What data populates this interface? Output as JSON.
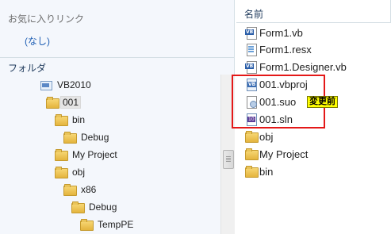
{
  "favorites": {
    "title": "お気に入りリンク",
    "empty": "(なし)"
  },
  "folders": {
    "title": "フォルダ",
    "tree": [
      {
        "label": "VB2010",
        "icon": "project-icon"
      },
      {
        "label": "001",
        "icon": "folder-icon",
        "selected": true
      },
      {
        "label": "bin",
        "icon": "folder-icon"
      },
      {
        "label": "Debug",
        "icon": "folder-icon"
      },
      {
        "label": "My Project",
        "icon": "folder-icon"
      },
      {
        "label": "obj",
        "icon": "folder-icon"
      },
      {
        "label": "x86",
        "icon": "folder-icon"
      },
      {
        "label": "Debug",
        "icon": "folder-icon"
      },
      {
        "label": "TempPE",
        "icon": "folder-icon"
      }
    ]
  },
  "file_list": {
    "column_header": "名前",
    "files": [
      {
        "label": "Form1.vb",
        "icon": "vb-file-icon"
      },
      {
        "label": "Form1.resx",
        "icon": "resx-file-icon"
      },
      {
        "label": "Form1.Designer.vb",
        "icon": "vb-file-icon"
      },
      {
        "label": "001.vbproj",
        "icon": "vbproj-file-icon"
      },
      {
        "label": "001.suo",
        "icon": "suo-file-icon"
      },
      {
        "label": "001.sln",
        "icon": "sln-file-icon"
      },
      {
        "label": "obj",
        "icon": "folder-icon"
      },
      {
        "label": "My Project",
        "icon": "folder-icon"
      },
      {
        "label": "bin",
        "icon": "folder-icon"
      }
    ]
  },
  "annotation": {
    "label": "変更前",
    "highlight_color": "#e41818",
    "label_color": "#ffff00"
  }
}
